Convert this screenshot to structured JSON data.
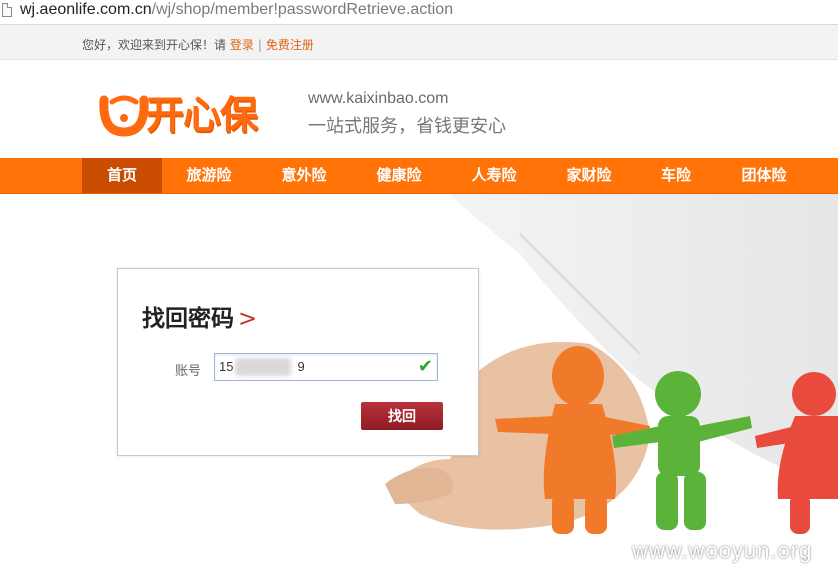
{
  "browser": {
    "url_host": "wj.aeonlife.com.cn",
    "url_path": "/wj/shop/member!passwordRetrieve.action"
  },
  "topbar": {
    "greeting": "您好，欢迎来到开心保！请",
    "login": "登录",
    "separator": "|",
    "register": "免费注册"
  },
  "header": {
    "logo_text": "开心保",
    "site_url": "www.kaixinbao.com",
    "slogan": "一站式服务，省钱更安心"
  },
  "nav": {
    "items": [
      {
        "label": "首页",
        "active": true
      },
      {
        "label": "旅游险"
      },
      {
        "label": "意外险"
      },
      {
        "label": "健康险"
      },
      {
        "label": "人寿险"
      },
      {
        "label": "家财险"
      },
      {
        "label": "车险"
      },
      {
        "label": "团体险"
      }
    ]
  },
  "retrieve": {
    "title": "找回密码",
    "title_arrow": ">",
    "account_label": "账号",
    "account_prefix": "15",
    "account_suffix": "9",
    "submit": "找回"
  },
  "watermark": "www.wooyun.org",
  "colors": {
    "nav_bg": "#ff7308",
    "nav_active": "#c94c00",
    "link": "#e0641a",
    "button": "#a6272f",
    "check": "#2aa52a"
  }
}
